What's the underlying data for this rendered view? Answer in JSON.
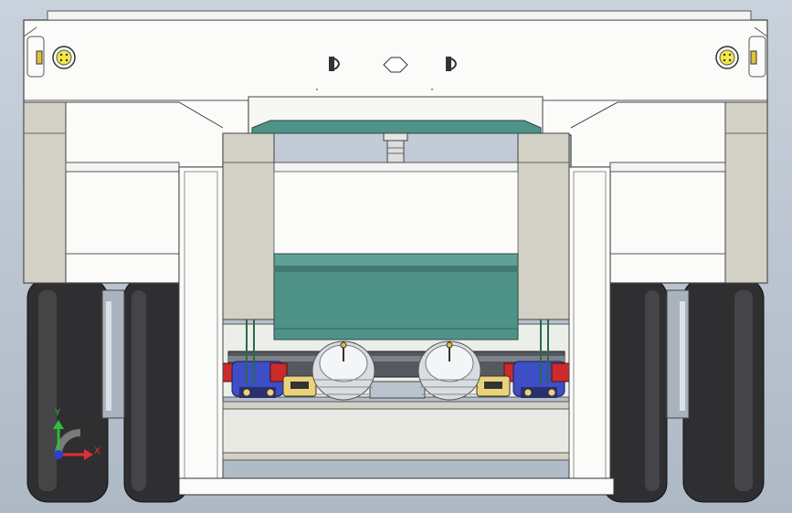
{
  "viewport": {
    "background_top": "#c9d2dc",
    "background_bottom": "#aeb9c6"
  },
  "colors": {
    "body_white": "#fbfbf9",
    "beige_panel": "#d3d0c6",
    "teal": "#4f9288",
    "teal_dark": "#2e6a62",
    "tire": "#2f2f31",
    "tire_highlight": "#5c5c60",
    "rim": "#a9b3bd",
    "lamp_yellow": "#f2e84a",
    "bumper_red": "#cc2b2b",
    "bumper_blue": "#3d4ec7",
    "bracket_yellow": "#e9d27a",
    "airbag_silver": "#d9dde2",
    "axle_dark": "#3b3e44"
  },
  "axis_triad": {
    "x_label": "X",
    "y_label": "Y",
    "x_color": "#e23030",
    "y_color": "#2fbf3a",
    "z_color": "#2f3fd0"
  },
  "icons": [
    "tail-lamp-icon",
    "coupling-hook-icon",
    "axis-triad-icon"
  ]
}
